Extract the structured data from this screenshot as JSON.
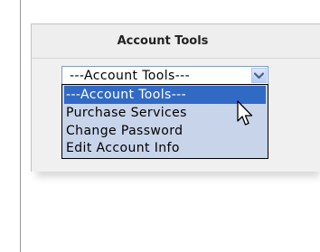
{
  "panel": {
    "title": "Account Tools"
  },
  "dropdown": {
    "selected_value": "---Account Tools---",
    "options": [
      "---Account Tools---",
      "Purchase Services",
      "Change Password",
      "Edit Account Info"
    ],
    "highlighted_option_index": 0
  },
  "icons": {
    "dropdown_arrow": "chevron-down-icon",
    "cursor": "mouse-pointer-icon"
  },
  "colors": {
    "highlight": "#316ac5",
    "list_background": "#c8d4ea",
    "select_border": "#7f9db9"
  }
}
